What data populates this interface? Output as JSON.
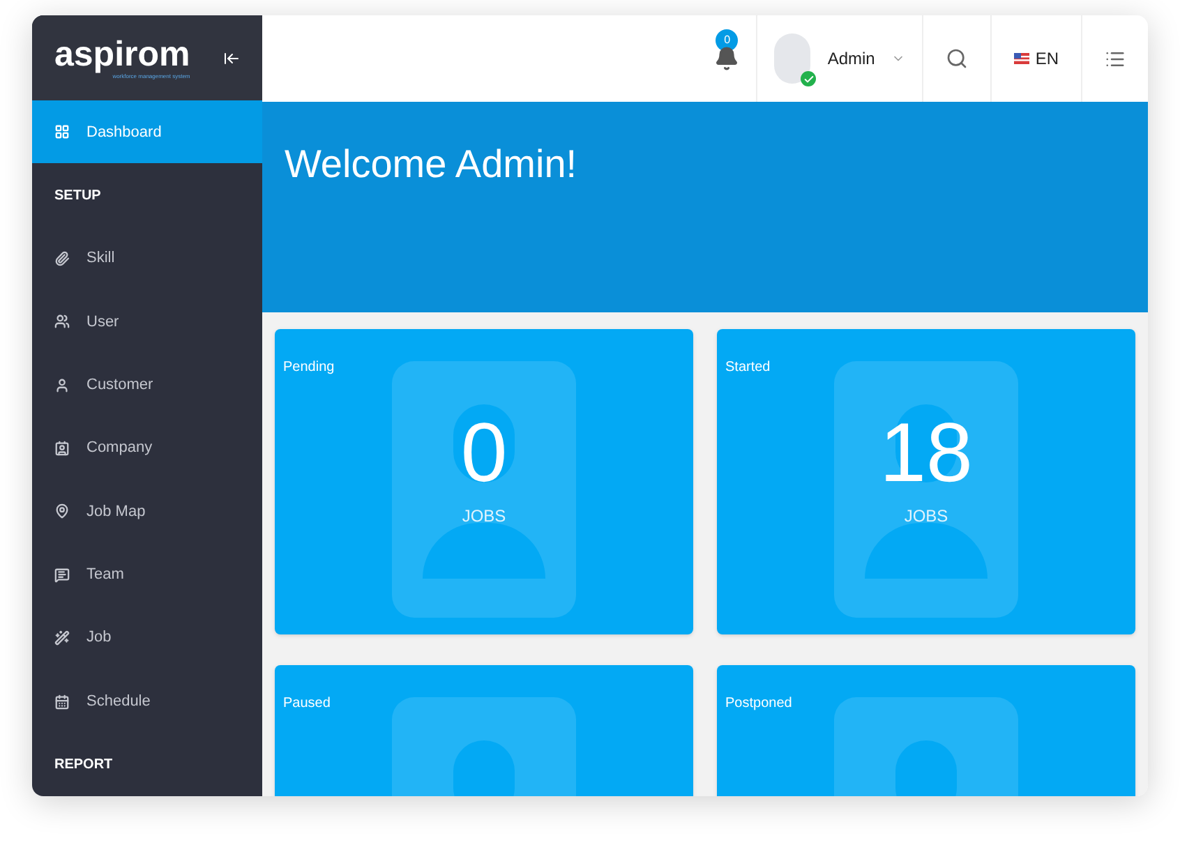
{
  "logo": {
    "name": "aspirom",
    "tagline": "workforce management system"
  },
  "header": {
    "notifications": {
      "count": "0"
    },
    "user": {
      "name": "Admin",
      "online": true
    },
    "language": "EN"
  },
  "sidebar": {
    "items": [
      {
        "kind": "item",
        "label": "Dashboard",
        "selected": true
      },
      {
        "kind": "section",
        "label": "SETUP"
      },
      {
        "kind": "item",
        "label": "Skill",
        "selected": false
      },
      {
        "kind": "item",
        "label": "User",
        "selected": false
      },
      {
        "kind": "item",
        "label": "Customer",
        "selected": false
      },
      {
        "kind": "item",
        "label": "Company",
        "selected": false
      },
      {
        "kind": "item",
        "label": "Job Map",
        "selected": false
      },
      {
        "kind": "item",
        "label": "Team",
        "selected": false
      },
      {
        "kind": "item",
        "label": "Job",
        "selected": false
      },
      {
        "kind": "item",
        "label": "Schedule",
        "selected": false
      },
      {
        "kind": "section",
        "label": "REPORT"
      }
    ]
  },
  "banner": {
    "title": "Welcome Admin!"
  },
  "cards": [
    {
      "title": "Pending",
      "count": "0",
      "unit": "JOBS"
    },
    {
      "title": "Started",
      "count": "18",
      "unit": "JOBS"
    },
    {
      "title": "Paused"
    },
    {
      "title": "Postponed"
    }
  ]
}
